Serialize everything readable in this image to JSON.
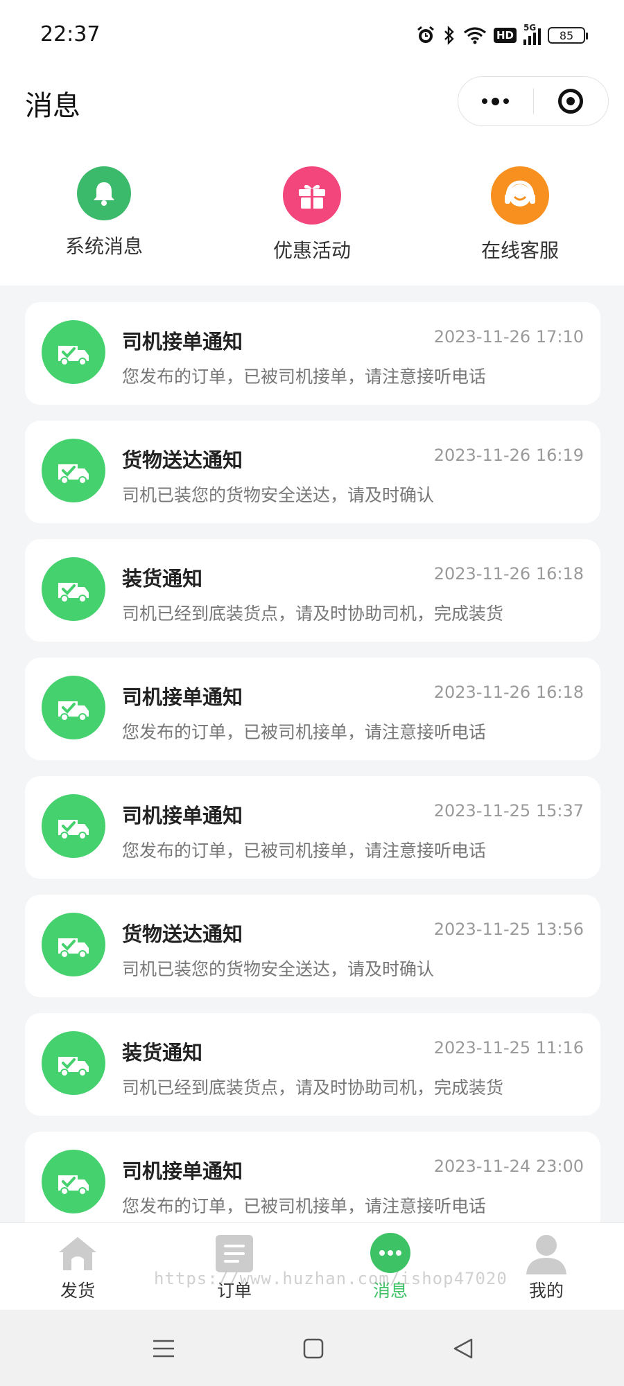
{
  "status_bar": {
    "time": "22:37",
    "icons": [
      "alarm-icon",
      "bluetooth-icon",
      "wifi-icon",
      "hd-icon",
      "signal-5g-icon"
    ],
    "hd_label": "HD",
    "network_label": "5G",
    "battery": "85"
  },
  "header": {
    "title": "消息"
  },
  "quick_actions": [
    {
      "label": "系统消息",
      "icon": "bell-icon",
      "color": "#3cba6b"
    },
    {
      "label": "优惠活动",
      "icon": "gift-icon",
      "color": "#f3467d"
    },
    {
      "label": "在线客服",
      "icon": "headset-icon",
      "color": "#f7901e"
    }
  ],
  "messages": [
    {
      "title": "司机接单通知",
      "time": "2023-11-26 17:10",
      "desc": "您发布的订单，已被司机接单，请注意接听电话"
    },
    {
      "title": "货物送达通知",
      "time": "2023-11-26 16:19",
      "desc": "司机已装您的货物安全送达，请及时确认"
    },
    {
      "title": "装货通知",
      "time": "2023-11-26 16:18",
      "desc": "司机已经到底装货点，请及时协助司机，完成装货"
    },
    {
      "title": "司机接单通知",
      "time": "2023-11-26 16:18",
      "desc": "您发布的订单，已被司机接单，请注意接听电话"
    },
    {
      "title": "司机接单通知",
      "time": "2023-11-25 15:37",
      "desc": "您发布的订单，已被司机接单，请注意接听电话"
    },
    {
      "title": "货物送达通知",
      "time": "2023-11-25 13:56",
      "desc": "司机已装您的货物安全送达，请及时确认"
    },
    {
      "title": "装货通知",
      "time": "2023-11-25 11:16",
      "desc": "司机已经到底装货点，请及时协助司机，完成装货"
    },
    {
      "title": "司机接单通知",
      "time": "2023-11-24 23:00",
      "desc": "您发布的订单，已被司机接单，请注意接听电话"
    }
  ],
  "message_icon": "truck-check-icon",
  "accent_color": "#45d16e",
  "tabbar": {
    "tabs": [
      {
        "label": "发货",
        "icon": "home-icon"
      },
      {
        "label": "订单",
        "icon": "document-icon"
      },
      {
        "label": "消息",
        "icon": "chat-bubble-icon",
        "active": true
      },
      {
        "label": "我的",
        "icon": "user-icon"
      }
    ],
    "watermark": "https://www.huzhan.com/ishop47020"
  },
  "system_nav": [
    "menu-icon",
    "home-square-icon",
    "back-triangle-icon"
  ]
}
